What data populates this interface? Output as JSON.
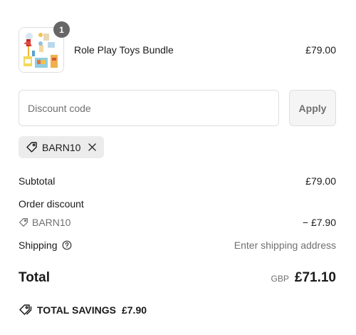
{
  "line_item": {
    "quantity": "1",
    "name": "Role Play Toys Bundle",
    "price": "£79.00",
    "thumbnail_icon": "product-thumbnail"
  },
  "discount": {
    "placeholder": "Discount code",
    "value": "",
    "apply_label": "Apply",
    "applied_code": "BARN10"
  },
  "summary": {
    "subtotal_label": "Subtotal",
    "subtotal_value": "£79.00",
    "order_discount_label": "Order discount",
    "discount_code": "BARN10",
    "discount_value": "− £7.90",
    "shipping_label": "Shipping",
    "shipping_value": "Enter shipping address",
    "total_label": "Total",
    "currency": "GBP",
    "total_value": "£71.10",
    "savings_label": "TOTAL SAVINGS",
    "savings_value": "£7.90"
  },
  "colors": {
    "badge": "#666666",
    "chip_bg": "#ececec",
    "muted_text": "#707070",
    "border": "#dedede"
  }
}
